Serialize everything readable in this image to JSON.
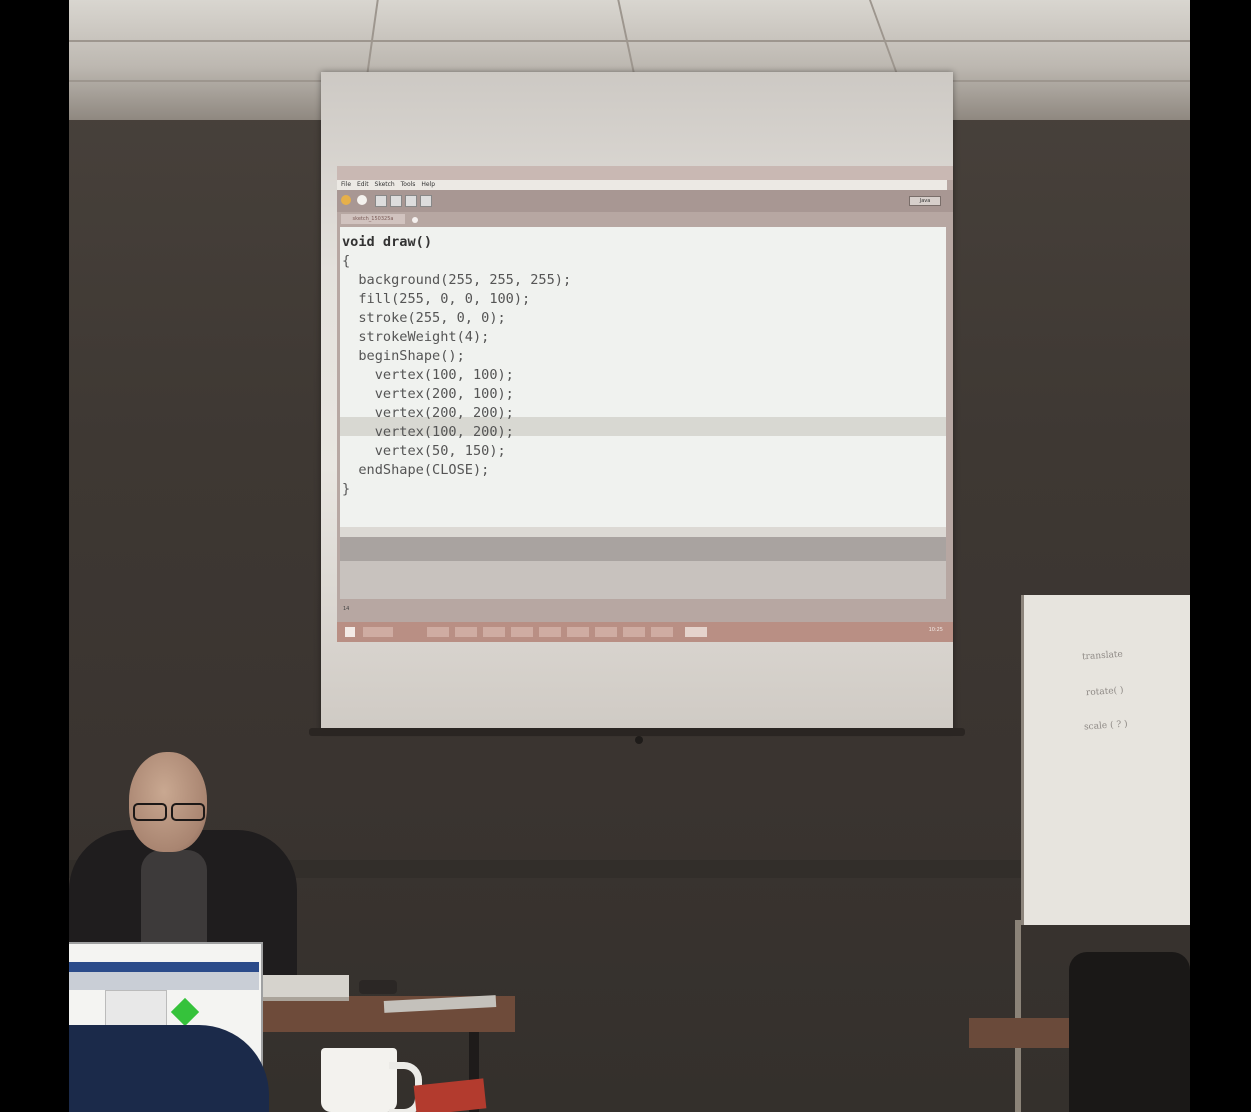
{
  "ide": {
    "menu": [
      "File",
      "Edit",
      "Sketch",
      "Tools",
      "Help"
    ],
    "tab_label": "sketch_150325a",
    "mode_label": "Java",
    "line_indicator": "14",
    "clock": "10:25"
  },
  "code_lines": [
    "void draw()",
    "{",
    "  background(255, 255, 255);",
    "  fill(255, 0, 0, 100);",
    "  stroke(255, 0, 0);",
    "  strokeWeight(4);",
    "  beginShape();",
    "    vertex(100, 100);",
    "    vertex(200, 100);",
    "    vertex(200, 200);",
    "    vertex(100, 200);",
    "    vertex(50, 150);",
    "  endShape(CLOSE);",
    "}"
  ],
  "flipchart_notes": [
    "translate",
    "rotate( )",
    "scale ( ? )"
  ]
}
